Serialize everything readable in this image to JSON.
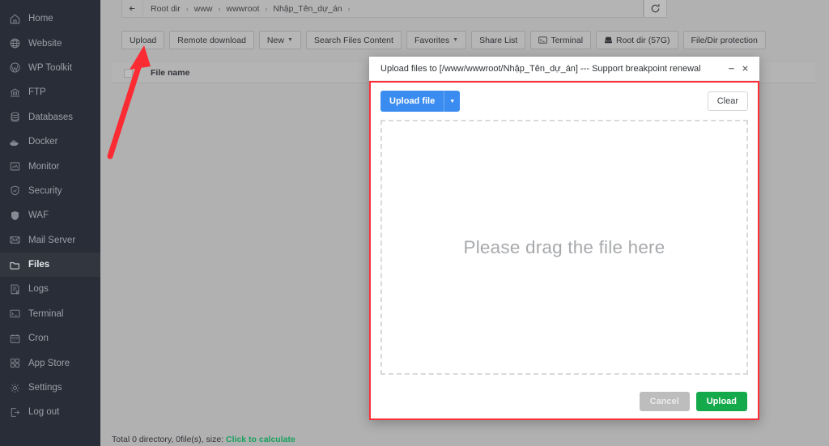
{
  "sidebar": {
    "items": [
      {
        "label": "Home",
        "icon": "home-icon",
        "active": false
      },
      {
        "label": "Website",
        "icon": "globe-icon",
        "active": false
      },
      {
        "label": "WP Toolkit",
        "icon": "wordpress-icon",
        "active": false
      },
      {
        "label": "FTP",
        "icon": "ftp-icon",
        "active": false
      },
      {
        "label": "Databases",
        "icon": "database-icon",
        "active": false
      },
      {
        "label": "Docker",
        "icon": "docker-icon",
        "active": false
      },
      {
        "label": "Monitor",
        "icon": "monitor-icon",
        "active": false
      },
      {
        "label": "Security",
        "icon": "shield-icon",
        "active": false
      },
      {
        "label": "WAF",
        "icon": "waf-shield-icon",
        "active": false
      },
      {
        "label": "Mail Server",
        "icon": "mail-icon",
        "active": false
      },
      {
        "label": "Files",
        "icon": "folder-icon",
        "active": true
      },
      {
        "label": "Logs",
        "icon": "log-icon",
        "active": false
      },
      {
        "label": "Terminal",
        "icon": "terminal-icon",
        "active": false
      },
      {
        "label": "Cron",
        "icon": "calendar-icon",
        "active": false
      },
      {
        "label": "App Store",
        "icon": "grid-icon",
        "active": false
      },
      {
        "label": "Settings",
        "icon": "gear-icon",
        "active": false
      },
      {
        "label": "Log out",
        "icon": "logout-icon",
        "active": false
      }
    ]
  },
  "breadcrumb": {
    "back_icon": "arrow-left-icon",
    "refresh_icon": "refresh-icon",
    "separator": "›",
    "items": [
      "Root dir",
      "www",
      "wwwroot",
      "Nhập_Tên_dự_án"
    ]
  },
  "toolbar": {
    "buttons": [
      {
        "label": "Upload",
        "caret": false,
        "icon": ""
      },
      {
        "label": "Remote download",
        "caret": false,
        "icon": ""
      },
      {
        "label": "New",
        "caret": true,
        "icon": ""
      },
      {
        "label": "Search Files Content",
        "caret": false,
        "icon": ""
      },
      {
        "label": "Favorites",
        "caret": true,
        "icon": ""
      },
      {
        "label": "Share List",
        "caret": false,
        "icon": ""
      },
      {
        "label": "Terminal",
        "caret": false,
        "icon": "terminal-icon"
      },
      {
        "label": "Root dir (57G)",
        "caret": false,
        "icon": "disk-icon"
      },
      {
        "label": "File/Dir protection",
        "caret": false,
        "icon": ""
      }
    ]
  },
  "file_list": {
    "select_all_checkbox": "select-all-checkbox",
    "columns": [
      "File name"
    ],
    "rows": []
  },
  "status": {
    "text": "Total 0 directory, 0file(s), size:",
    "calculate_link": "Click to calculate",
    "link_color": "#1aa05e"
  },
  "dialog": {
    "title": "Upload files to [/www/wwwroot/Nhập_Tên_dự_án] --- Support breakpoint renewal",
    "minimize_icon": "minimize-icon",
    "close_icon": "close-icon",
    "upload_file_label": "Upload file",
    "upload_file_caret": "▾",
    "clear_label": "Clear",
    "dropzone_text": "Please drag the file here",
    "cancel_label": "Cancel",
    "upload_label": "Upload",
    "accent_color": "#3b8cf0",
    "upload_color": "#14aa4b",
    "highlight_border_color": "#ff2f3a"
  },
  "annotation": {
    "arrow_color": "#fb2b34",
    "arrow_target": "Upload"
  }
}
